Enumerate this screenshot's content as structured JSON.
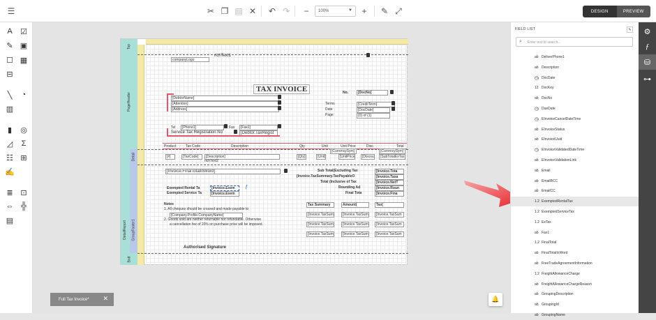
{
  "toolbar": {
    "zoom_value": "100%",
    "design_label": "DESIGN",
    "preview_label": "PREVIEW"
  },
  "report": {
    "band_top": "Top",
    "band_page_header": "PageHeader",
    "band_detail": "Detail",
    "band_detail_report": "DetailReport",
    "band_group_footer": "GroupFooter1",
    "band_bottom": "Bott",
    "company_logo": "companyLogo",
    "rich_text1": "richText1",
    "title": "TAX INVOICE",
    "no_label": "No.",
    "doc_no": "[DocNo]",
    "debtor_name": "[DebtorName]",
    "attention": "[Attention]",
    "address": "[Address]",
    "terms_label": "Terms",
    "credit_term": "[CreditTerm]",
    "date_label": "Date",
    "doc_date": "[DocDate]",
    "page_label": "Page",
    "page_value": "{0} of {1}",
    "tel_label": "Tel",
    "phone1": "[Phone1]",
    "fax_label": "Fax",
    "fax1": "[Fax1]",
    "service_tax_label": "Service Tax Registration No",
    "debtor_tax_reg": "[Debtor.TaxRegist",
    "col_product": "Product",
    "col_tax_code": "Tax Code",
    "col_description": "Description",
    "col_qty": "Qty",
    "col_unit": "Unit",
    "col_unit_price": "Unit Price",
    "col_disc": "Disc.",
    "col_total": "Total",
    "currency_sym1": "[CurrencySym]",
    "currency_sym2": "[CurrencySym]",
    "d_hash": "[#]",
    "d_tax_code": "[TaxCode]",
    "d_description": "[Description]",
    "d_qty": "[Qty]",
    "d_unit": "[Unit]",
    "d_unit_price": "[UnitPrice]",
    "d_discount": "[Discou",
    "d_subtotal": "[SubTotalExTax",
    "rich_text2": "richText2",
    "final_total_word": "[Invoice.FinalTotalInWord]",
    "sub_total_label": "Sub Total(Excluding Tax",
    "sub_total_value": "[Invoice.Tota",
    "tax_summary_value_label": "[Invoice.TaxSummary.TaxPayableO",
    "tax_summary_value2": "[Invoice.Taxa",
    "total_incl_label": "Total (Inclusive of Tax",
    "total_incl_value": "[Invoice.NetT",
    "rounding_label": "Rounding Ad",
    "rounding_value": "[Invoice.Roun",
    "final_total_label": "Final Tota",
    "final_total_value": "[Invoice.Fina",
    "exempted_rental_label": "Exempted Rental Ta",
    "exempted_rental_value": "[Invoice.Exem",
    "exempted_service_label": "Exempted Service Ta",
    "exempted_service_value": "[Invoice.Exem",
    "notes_label": "Notes",
    "note1": "1. All cheques should be crossed and made payable to",
    "company_profile": "[Company.Profile.CompanyName]",
    "note2a": "2. Goods sold are neither returnable nor refundable. Otherwise",
    "note2b": "a cancellation fee of 20% on purchase price will be imposed.",
    "tax_summary_label": "Tax Summary",
    "amount_label": "Amount(",
    "tax_col_label": "Tax(",
    "ts_cell1": "[Invoice.TaxSumm",
    "ts_cell2": "[Invoice.TaxSum",
    "ts_cell3": "[Invoice.TaxSum",
    "authorised_signature": "Authorised Signature"
  },
  "field_list": {
    "title": "FIELD LIST",
    "search_placeholder": "Enter text to search...",
    "items": [
      {
        "type": "ab",
        "name": "DeliverPhone1"
      },
      {
        "type": "ab",
        "name": "Description"
      },
      {
        "type": "clock",
        "name": "DocDate"
      },
      {
        "type": "12",
        "name": "DocKey"
      },
      {
        "type": "ab",
        "name": "DocNo"
      },
      {
        "type": "clock",
        "name": "DueDate"
      },
      {
        "type": "clock",
        "name": "EInvoiceCancelDateTime"
      },
      {
        "type": "ab",
        "name": "EInvoiceStatus"
      },
      {
        "type": "ab",
        "name": "EInvoiceUuid"
      },
      {
        "type": "clock",
        "name": "EInvoiceValidatedDateTime"
      },
      {
        "type": "ab",
        "name": "EInvoiceValidationLink"
      },
      {
        "type": "ab",
        "name": "Email"
      },
      {
        "type": "ab",
        "name": "EmailBCC"
      },
      {
        "type": "ab",
        "name": "EmailCC"
      },
      {
        "type": "1.2",
        "name": "ExemptedRentalTax"
      },
      {
        "type": "1.2",
        "name": "ExemptedServiceTax"
      },
      {
        "type": "1.2",
        "name": "ExTax"
      },
      {
        "type": "ab",
        "name": "Fax1"
      },
      {
        "type": "1.2",
        "name": "FinalTotal"
      },
      {
        "type": "ab",
        "name": "FinalTotalInWord"
      },
      {
        "type": "ab",
        "name": "FreeTradeAgreementInformation"
      },
      {
        "type": "1.2",
        "name": "FreightAllowanceCharge"
      },
      {
        "type": "ab",
        "name": "FreightAllowanceChargeReason"
      },
      {
        "type": "ab",
        "name": "GroupingDescription"
      },
      {
        "type": "ab",
        "name": "GroupingId"
      },
      {
        "type": "ab",
        "name": "GroupingName"
      }
    ]
  },
  "bottom_tab": {
    "label": "Full Tax Invoice*"
  },
  "colors": {
    "accent_red": "#e8232a",
    "teal_band": "#a8e0d8",
    "ruler_yellow": "#f5e9a8",
    "dark_strip": "#444444"
  }
}
